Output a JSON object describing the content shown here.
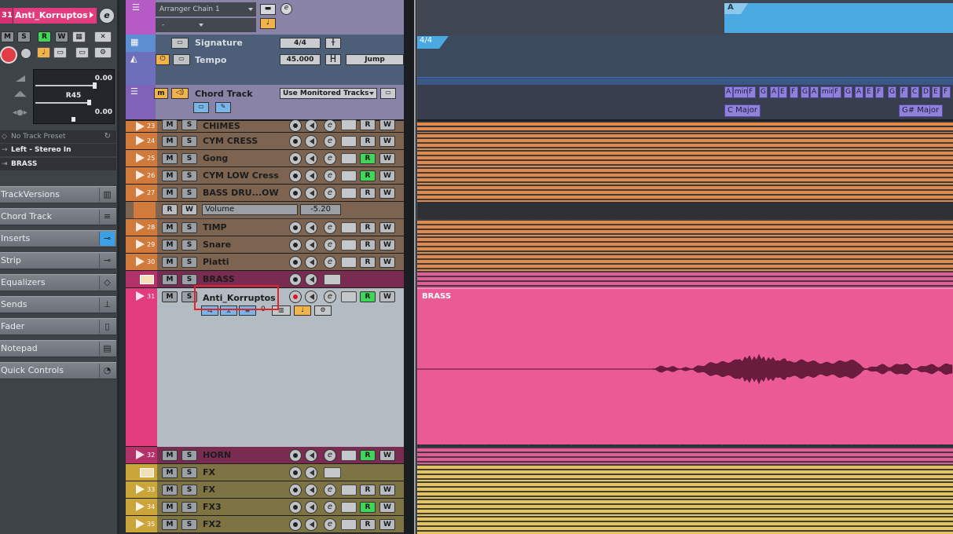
{
  "inspector": {
    "track_number": "31",
    "track_name": "Anti_Korruptos",
    "buttons": [
      "M",
      "S",
      "R",
      "W"
    ],
    "volume_value": "0.00",
    "pan_value": "R45",
    "delay_value": "0.00",
    "no_preset": "No Track Preset",
    "input_routing": "Left - Stereo In",
    "output_routing": "BRASS",
    "sections": [
      "TrackVersions",
      "Chord Track",
      "Inserts",
      "Strip",
      "Equalizers",
      "Sends",
      "Fader",
      "Notepad",
      "Quick Controls"
    ]
  },
  "header_tracks": {
    "arranger_chain": "Arranger Chain 1",
    "arranger_sub": "-",
    "signature_label": "Signature",
    "signature_value": "4/4",
    "tempo_label": "Tempo",
    "tempo_value": "45.000",
    "tempo_mode": "Jump",
    "chord_label": "Chord Track",
    "chord_mode": "Use Monitored Tracks"
  },
  "tracks": [
    {
      "num": "23",
      "name": "CHIMES",
      "color": "#d07a3c"
    },
    {
      "num": "24",
      "name": "CYM CRESS",
      "color": "#d07a3c"
    },
    {
      "num": "25",
      "name": "Gong",
      "color": "#d07a3c"
    },
    {
      "num": "26",
      "name": "CYM LOW Cress",
      "color": "#d07a3c"
    },
    {
      "num": "27",
      "name": "BASS DRU...OW",
      "color": "#d07a3c"
    },
    {
      "num": "28",
      "name": "TIMP",
      "color": "#d07a3c"
    },
    {
      "num": "29",
      "name": "Snare",
      "color": "#d07a3c"
    },
    {
      "num": "30",
      "name": "Piatti",
      "color": "#d07a3c"
    },
    {
      "num": "",
      "name": "BRASS",
      "color": "#b3326a"
    },
    {
      "num": "31",
      "name": "Anti_Korruptos",
      "color": "#e23c7f"
    },
    {
      "num": "32",
      "name": "HORN",
      "color": "#b3326a"
    },
    {
      "num": "",
      "name": "FX",
      "color": "#c9a53a"
    },
    {
      "num": "33",
      "name": "FX",
      "color": "#c9a53a"
    },
    {
      "num": "34",
      "name": "FX3",
      "color": "#c9a53a"
    },
    {
      "num": "35",
      "name": "FX2",
      "color": "#c9a53a"
    }
  ],
  "automation": {
    "rw_r": "R",
    "rw_w": "W",
    "param": "Volume",
    "value": "-5.20"
  },
  "project": {
    "arranger_marker": "A",
    "signature_marker": "4/4",
    "chords": "A min F G A E F G A min F G A E F G F C D E F",
    "chord_chunks": [
      "A",
      "min",
      "F",
      "G",
      "A",
      "E",
      "F",
      "G",
      "A",
      "min",
      "F",
      "G",
      "A",
      "E",
      "F",
      "G",
      "F",
      "C",
      "D",
      "E",
      "F"
    ],
    "scale1": "C Major",
    "scale2": "G# Major",
    "event_label": "BRASS"
  },
  "colors": {
    "orange": "#e38a4b",
    "pink": "#ea5b96",
    "yellow": "#e6c45a",
    "blue": "#4aa9e0"
  }
}
